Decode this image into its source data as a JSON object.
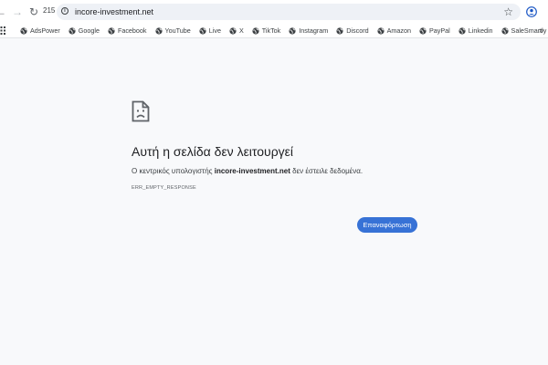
{
  "toolbar": {
    "back_glyph": "←",
    "forward_glyph": "→",
    "reload_glyph": "↻",
    "reload_count": "215",
    "url": "incore-investment.net",
    "info_icon_glyph": "i",
    "star_glyph": "☆"
  },
  "icons": {
    "back": "back-arrow-icon",
    "forward": "forward-arrow-icon",
    "reload": "reload-icon",
    "info": "site-info-icon",
    "star": "bookmark-star-icon",
    "profile": "profile-icon",
    "apps": "apps-grid-icon",
    "bookmark": "globe-icon",
    "more": "chevron-double-right-icon",
    "error": "sad-page-icon"
  },
  "bookmarks": {
    "items": [
      {
        "label": "AdsPower"
      },
      {
        "label": "Google"
      },
      {
        "label": "Facebook"
      },
      {
        "label": "YouTube"
      },
      {
        "label": "Live"
      },
      {
        "label": "X"
      },
      {
        "label": "TikTok"
      },
      {
        "label": "Instagram"
      },
      {
        "label": "Discord"
      },
      {
        "label": "Amazon"
      },
      {
        "label": "PayPal"
      },
      {
        "label": "Linkedin"
      },
      {
        "label": "SaleSmartly"
      }
    ],
    "more_glyph": "»"
  },
  "error": {
    "title": "Αυτή η σελίδα δεν λειτουργεί",
    "desc_prefix": "Ο κεντρικός υπολογιστής ",
    "desc_host": "incore-investment.net",
    "desc_suffix": " δεν έστειλε δεδομένα.",
    "code": "ERR_EMPTY_RESPONSE",
    "reload_label": "Επαναφόρτωση"
  },
  "colors": {
    "accent": "#3772d6",
    "page_bg": "#f8f9fb",
    "omnibox_bg": "#eef1f6"
  }
}
